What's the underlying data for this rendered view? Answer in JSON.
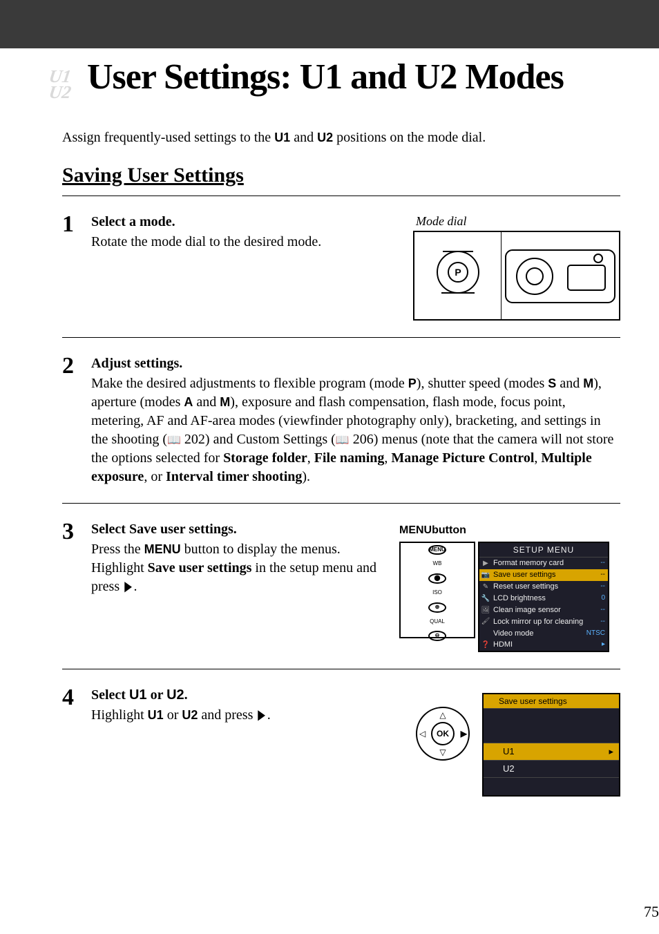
{
  "header": {
    "title": "User Settings: U1 and U2 Modes"
  },
  "intro": {
    "pre": "Assign frequently-used settings to the ",
    "u1": "U1",
    "mid": " and ",
    "u2": "U2",
    "post": " positions on the mode dial."
  },
  "section_title": "Saving User Settings",
  "step1": {
    "num": "1",
    "head": "Select a mode.",
    "body": "Rotate the mode dial to the desired mode.",
    "caption": "Mode dial"
  },
  "step2": {
    "num": "2",
    "head": "Adjust settings.",
    "p1": "Make the desired adjustments to flexible program (mode ",
    "P": "P",
    "p2": "), shutter speed (modes ",
    "S": "S",
    "p3": " and ",
    "M": "M",
    "p4": "), aperture (modes ",
    "A": "A",
    "p5": " and ",
    "M2": "M",
    "p6": "), exposure and flash compensation, flash mode, focus point, metering, AF and AF-area modes (viewfinder photography only), bracketing, and settings in the shooting (",
    "ref1": "202",
    "p7": ") and Custom Settings (",
    "ref2": "206",
    "p8": ") menus (note that the camera will not store the options selected for ",
    "b1": "Storage folder",
    "c1": ", ",
    "b2": "File naming",
    "c2": ", ",
    "b3": "Manage Picture Control",
    "c3": ", ",
    "b4": "Multiple exposure",
    "c4": ", or ",
    "b5": "Interval timer shooting",
    "c5": ")."
  },
  "step3": {
    "num": "3",
    "head_pre": "Select ",
    "head_b": "Save user settings",
    "head_post": ".",
    "body_pre": "Press the ",
    "body_menu": "MENU",
    "body_mid": " button to display the menus. Highlight ",
    "body_b": "Save user settings",
    "body_post": " in the setup menu and press ",
    "arrow": "▶",
    "body_end": ".",
    "label": "MENU",
    "label_suffix": " button"
  },
  "setup_menu": {
    "title": "SETUP MENU",
    "items": [
      {
        "label": "Format memory card",
        "val": "--"
      },
      {
        "label": "Save user settings",
        "val": "--",
        "hl": true
      },
      {
        "label": "Reset user settings",
        "val": "--"
      },
      {
        "label": "LCD brightness",
        "val": "0"
      },
      {
        "label": "Clean image sensor",
        "val": "--"
      },
      {
        "label": "Lock mirror up for cleaning",
        "val": "--"
      },
      {
        "label": "Video mode",
        "val": "NTSC"
      },
      {
        "label": "HDMI",
        "val": "▸"
      }
    ]
  },
  "step4": {
    "num": "4",
    "head_pre": "Select ",
    "head_u1": "U1",
    "head_or": " or ",
    "head_u2": "U2",
    "head_post": ".",
    "body_pre": "Highlight ",
    "b1": "U1",
    "or": " or ",
    "b2": "U2",
    "body_mid": " and press ",
    "arrow": "▶",
    "body_end": "."
  },
  "save_menu": {
    "title": "Save user settings",
    "u1": "U1",
    "u2": "U2",
    "arrow": "▸"
  },
  "page_number": "75"
}
